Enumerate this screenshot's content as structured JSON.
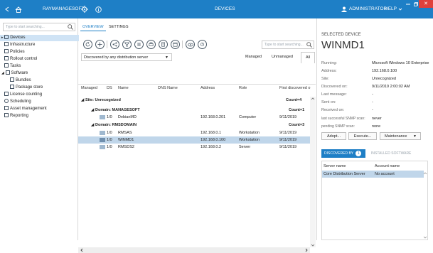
{
  "app": {
    "name": "RAYMANAGESOFT",
    "section_title": "DEVICES",
    "user": "ADMINISTRATOR",
    "help": "HELP",
    "close_glyph": "✕"
  },
  "sidebar": {
    "search_placeholder": "Type to start searching...",
    "items": [
      {
        "label": "Devices"
      },
      {
        "label": "Infrastructure"
      },
      {
        "label": "Policies"
      },
      {
        "label": "Rollout control"
      },
      {
        "label": "Tasks"
      },
      {
        "label": "Software"
      },
      {
        "label": "Bundles"
      },
      {
        "label": "Package store"
      },
      {
        "label": "License counting"
      },
      {
        "label": "Scheduling"
      },
      {
        "label": "Asset management"
      },
      {
        "label": "Reporting"
      }
    ]
  },
  "tabs": {
    "overview": "OVERVIEW",
    "settings": "SETTINGS"
  },
  "filter": {
    "dropdown": "Discovered by any distribution server",
    "search_placeholder": "Type to start searching...",
    "segments": [
      "Managed",
      "Unmanaged",
      "All"
    ]
  },
  "grid": {
    "columns": [
      "Managed",
      "DS",
      "Name",
      "DNS Name",
      "Address",
      "Role",
      "First discovered o"
    ],
    "site": {
      "label": "Site: Unrecognized",
      "count": "Count=4"
    },
    "groups": [
      {
        "label": "Domain: MANAGESOFT",
        "count": "Count=1",
        "rows": [
          {
            "ds": "1/0",
            "name": "DebianMD",
            "dns": "",
            "address": "192.168.0.201",
            "role": "Computer",
            "first": "9/11/2019"
          }
        ]
      },
      {
        "label": "Domain: RMSDOMAIN",
        "count": "Count=3",
        "rows": [
          {
            "ds": "1/0",
            "name": "RMSAS",
            "dns": "",
            "address": "192.168.0.1",
            "role": "Workstation",
            "first": "9/11/2019"
          },
          {
            "ds": "1/0",
            "name": "WINMD1",
            "dns": "",
            "address": "192.168.0.100",
            "role": "Workstation",
            "first": "9/11/2019"
          },
          {
            "ds": "1/0",
            "name": "RMSDS2",
            "dns": "",
            "address": "192.168.0.2",
            "role": "Server",
            "first": "9/11/2019"
          }
        ]
      }
    ]
  },
  "details": {
    "header": "SELECTED DEVICE",
    "name": "WINMD1",
    "fields": [
      {
        "label": "Running:",
        "value": "Microsoft Windows 10 Enterprise"
      },
      {
        "label": "Address:",
        "value": "192.168.0.100"
      },
      {
        "label": "Site:",
        "value": "Unrecognized"
      },
      {
        "label": "Discovered on:",
        "value": "9/11/2019 2:00:02 AM"
      },
      {
        "label": "Last message:",
        "value": "-"
      },
      {
        "label": "Sent on:",
        "value": "-"
      },
      {
        "label": "Received on:",
        "value": "-"
      },
      {
        "label": "last successful SNMP scan:",
        "value": "never"
      },
      {
        "label": "pending SNMP scan:",
        "value": "none"
      }
    ],
    "buttons": {
      "adopt": "Adopt...",
      "execute": "Execute...",
      "maintenance": "Maintenance"
    },
    "subtabs": {
      "discovered_by": "DISCOVERED BY",
      "discovered_count": "1",
      "installed": "INSTALLED SOFTWARE"
    },
    "table": {
      "columns": [
        "Server name",
        "Account name"
      ],
      "rows": [
        {
          "server": "Core Distribution Server",
          "account": "No account"
        }
      ]
    }
  },
  "colors": {
    "accent": "#1e7fc6",
    "selection": "#c0d6ea",
    "close": "#e0413b"
  }
}
